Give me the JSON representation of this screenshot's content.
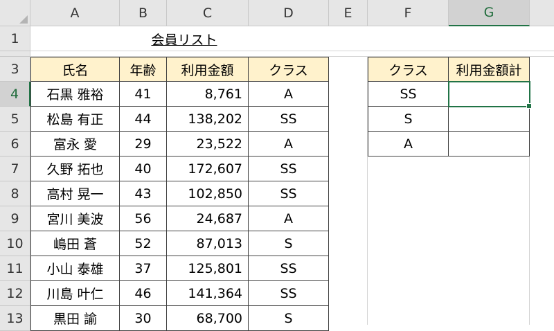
{
  "columns": [
    "A",
    "B",
    "C",
    "D",
    "E",
    "F",
    "G"
  ],
  "rows": [
    "1",
    "",
    "3",
    "4",
    "5",
    "6",
    "7",
    "8",
    "9",
    "10",
    "11",
    "12",
    "13"
  ],
  "selection": {
    "cell": "G4",
    "column": "G",
    "row": "4"
  },
  "sheet_title": "会員リスト",
  "member_table": {
    "headers": [
      "氏名",
      "年齢",
      "利用金額",
      "クラス"
    ],
    "rows": [
      [
        "石黒 雅裕",
        "41",
        "8,761",
        "A"
      ],
      [
        "松島 有正",
        "44",
        "138,202",
        "SS"
      ],
      [
        "富永 愛",
        "29",
        "23,522",
        "A"
      ],
      [
        "久野 拓也",
        "40",
        "172,607",
        "SS"
      ],
      [
        "高村 晃一",
        "43",
        "102,850",
        "SS"
      ],
      [
        "宮川 美波",
        "56",
        "24,687",
        "A"
      ],
      [
        "嶋田 蒼",
        "52",
        "87,013",
        "S"
      ],
      [
        "小山 泰雄",
        "37",
        "125,801",
        "SS"
      ],
      [
        "川島 叶仁",
        "46",
        "141,364",
        "SS"
      ],
      [
        "黒田 諭",
        "30",
        "68,700",
        "S"
      ]
    ]
  },
  "summary_table": {
    "headers": [
      "クラス",
      "利用金額計"
    ],
    "rows": [
      [
        "SS",
        ""
      ],
      [
        "S",
        ""
      ],
      [
        "A",
        ""
      ]
    ]
  },
  "colors": {
    "header_fill": "#fff2cc",
    "selection_accent": "#217346",
    "border": "#404040",
    "gridline": "#d4d4d4"
  }
}
